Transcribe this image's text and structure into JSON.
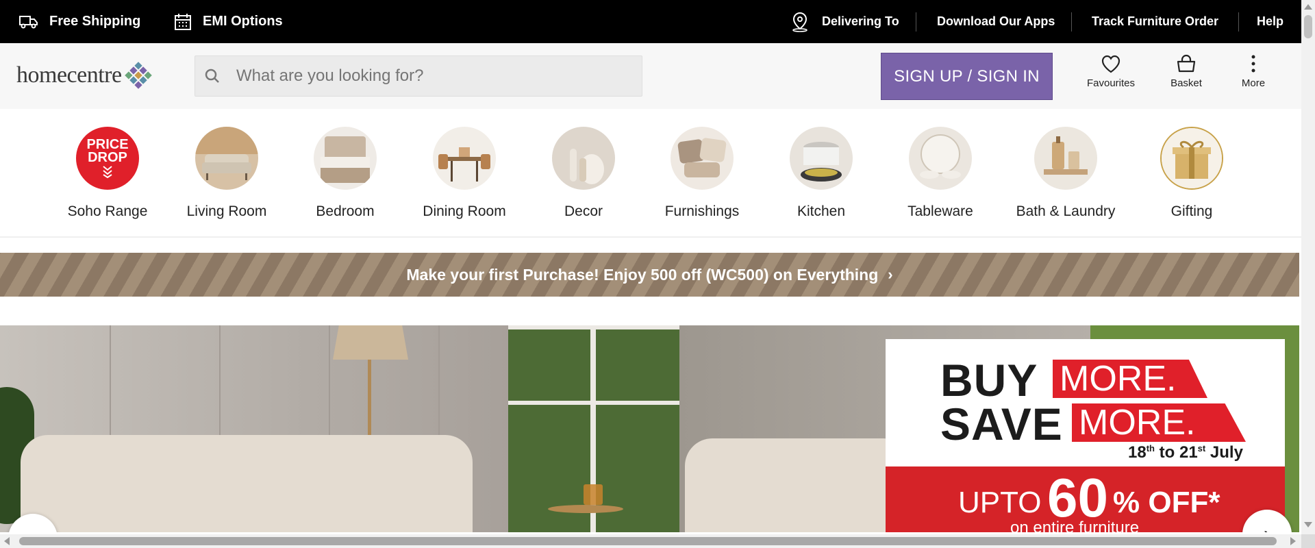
{
  "topbar": {
    "free_shipping": "Free Shipping",
    "emi_options": "EMI Options",
    "delivering_to": "Delivering To",
    "download_apps": "Download Our Apps",
    "track_order": "Track Furniture Order",
    "help": "Help"
  },
  "header": {
    "logo_text": "homecentre",
    "search_placeholder": "What are you looking for?",
    "signin_label": "SIGN UP / SIGN IN",
    "favourites": "Favourites",
    "basket": "Basket",
    "more": "More",
    "accent_color": "#7a63a9"
  },
  "categories": [
    {
      "name": "Soho Range",
      "badge_line1": "PRICE",
      "badge_line2": "DROP"
    },
    {
      "name": "Living Room"
    },
    {
      "name": "Bedroom"
    },
    {
      "name": "Dining Room"
    },
    {
      "name": "Decor"
    },
    {
      "name": "Furnishings"
    },
    {
      "name": "Kitchen"
    },
    {
      "name": "Tableware"
    },
    {
      "name": "Bath & Laundry"
    },
    {
      "name": "Gifting"
    }
  ],
  "promo": {
    "text": "Make your first Purchase! Enjoy 500 off (WC500) on Everything",
    "chevron": "›"
  },
  "hero": {
    "buy": "BUY",
    "more1": "MORE.",
    "save": "SAVE",
    "more2": "MORE.",
    "dates_from": "18",
    "dates_from_sup": "th",
    "dates_to_word": " to 21",
    "dates_to_sup": "st",
    "dates_month": " July",
    "upto": "UPTO",
    "percent": "60",
    "off": "% OFF*",
    "sub": "on entire furniture",
    "brand_red": "#d52328",
    "prev": "‹",
    "next": "›"
  }
}
